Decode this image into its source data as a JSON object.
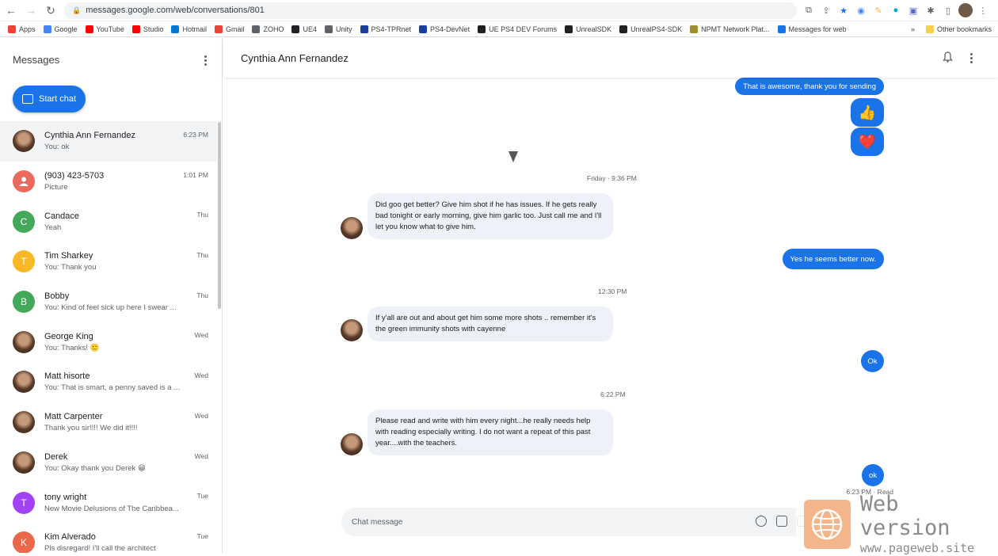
{
  "browser": {
    "url": "messages.google.com/web/conversations/801",
    "bookmarks": [
      {
        "label": "Apps",
        "color": "#ea4335"
      },
      {
        "label": "Google",
        "color": "#4285f4"
      },
      {
        "label": "YouTube",
        "color": "#ff0000"
      },
      {
        "label": "Studio",
        "color": "#ff0000"
      },
      {
        "label": "Hotmail",
        "color": "#0078d4"
      },
      {
        "label": "Gmail",
        "color": "#ea4335"
      },
      {
        "label": "ZOHO",
        "color": "#5f6368"
      },
      {
        "label": "UE4",
        "color": "#202124"
      },
      {
        "label": "Unity",
        "color": "#5f6368"
      },
      {
        "label": "PS4-TPRnet",
        "color": "#1a3e9c"
      },
      {
        "label": "PS4-DevNet",
        "color": "#1a3e9c"
      },
      {
        "label": "UE PS4 DEV Forums",
        "color": "#202124"
      },
      {
        "label": "UnrealSDK",
        "color": "#202124"
      },
      {
        "label": "UnrealPS4-SDK",
        "color": "#202124"
      },
      {
        "label": "NPMT Network Plat...",
        "color": "#9c8f2c"
      },
      {
        "label": "Messages for web",
        "color": "#1a73e8"
      }
    ],
    "more": "»",
    "other_bookmarks": "Other bookmarks"
  },
  "sidebar": {
    "title": "Messages",
    "start_chat": "Start chat",
    "conversations": [
      {
        "name": "Cynthia Ann Fernandez",
        "snippet": "You: ok",
        "time": "6:23 PM",
        "initial": "",
        "color": "#7a5a48",
        "photo": true
      },
      {
        "name": "(903) 423-5703",
        "snippet": "Picture",
        "time": "1:01 PM",
        "initial": "",
        "color": "#ea6b5e",
        "photo": false
      },
      {
        "name": "Candace",
        "snippet": "Yeah",
        "time": "Thu",
        "initial": "C",
        "color": "#43a85a",
        "photo": false
      },
      {
        "name": "Tim Sharkey",
        "snippet": "You: Thank you",
        "time": "Thu",
        "initial": "T",
        "color": "#f9b825",
        "photo": false
      },
      {
        "name": "Bobby",
        "snippet": "You: Kind of feel sick up here I swear ...",
        "time": "Thu",
        "initial": "B",
        "color": "#43a85a",
        "photo": false
      },
      {
        "name": "George King",
        "snippet": "You: Thanks! 🙂",
        "time": "Wed",
        "initial": "",
        "color": "#6f5a4a",
        "photo": true
      },
      {
        "name": "Matt hisorte",
        "snippet": "You: That is smart, a penny saved is a ...",
        "time": "Wed",
        "initial": "",
        "color": "#6f5a4a",
        "photo": true
      },
      {
        "name": "Matt Carpenter",
        "snippet": "Thank you sir!!!! We did it!!!!",
        "time": "Wed",
        "initial": "",
        "color": "#6f5a4a",
        "photo": true
      },
      {
        "name": "Derek",
        "snippet": "You: Okay thank you Derek 😁",
        "time": "Wed",
        "initial": "",
        "color": "#6f5a4a",
        "photo": true
      },
      {
        "name": "tony wright",
        "snippet": "New Movie Delusions of The Caribbea...",
        "time": "Tue",
        "initial": "T",
        "color": "#a142f4",
        "photo": false
      },
      {
        "name": "Kim Alverado",
        "snippet": "Pls disregard! I'll call the architect",
        "time": "Tue",
        "initial": "K",
        "color": "#e8684a",
        "photo": false
      }
    ]
  },
  "chat": {
    "contact": "Cynthia Ann Fernandez",
    "messages": {
      "out1": "That is awesome, thank you for sending",
      "thumbs": "👍",
      "heart": "❤️",
      "ts1": "Friday · 9:36 PM",
      "in1": "Did goo get better? Give him shot if he has issues. If he gets really bad tonight or early morning, give him garlic too. Just call me and I'll let you know what to give him.",
      "out2": "Yes he seems better now.",
      "ts2": "12:30 PM",
      "in2": "If y'all are out and about get him some more shots .. remember it's the green immunity shots with cayenne",
      "out3": "Ok",
      "ts3": "6:22 PM",
      "in3": "Please read and write with him every night...he really needs help with reading especially writing. I do not want a repeat of this past year....with the teachers.",
      "out4": "ok",
      "status": "6:23 PM · Read"
    },
    "compose_placeholder": "Chat message"
  },
  "watermark": {
    "title": "Web version",
    "url": "www.pageweb.site"
  }
}
